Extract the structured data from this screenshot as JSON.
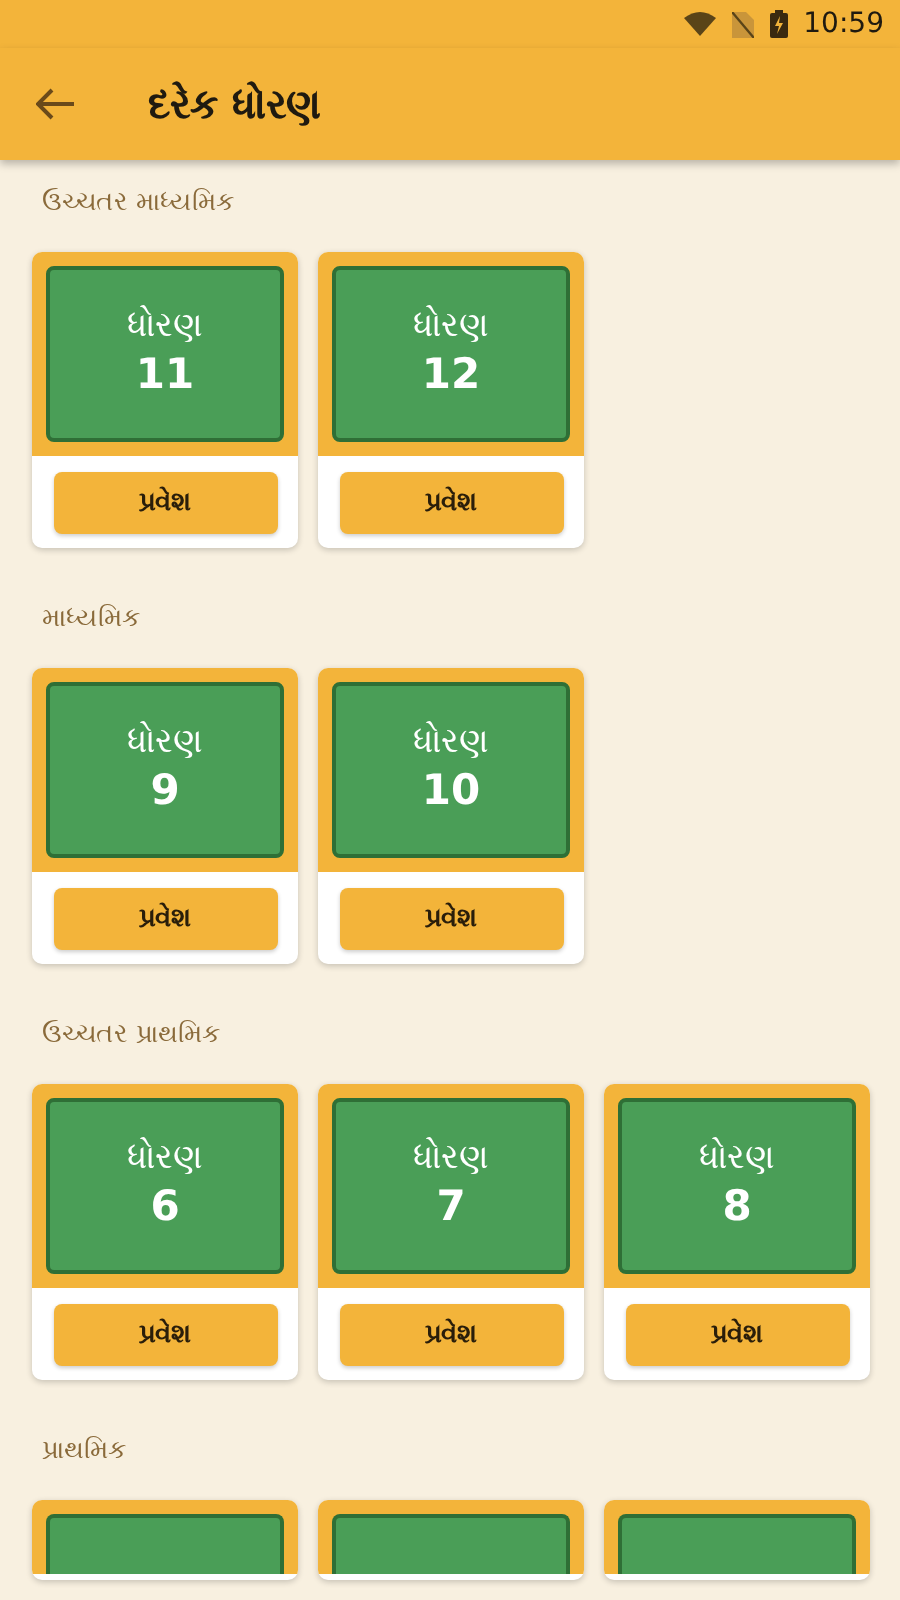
{
  "status_bar": {
    "time": "10:59"
  },
  "toolbar": {
    "title": "દરેક ધોરણ"
  },
  "sections": [
    {
      "title": "ઉચ્ચતર માધ્યમિક",
      "cards": [
        {
          "kind": "full",
          "label": "ધોરણ",
          "number": "11",
          "button": "પ્રવેશ"
        },
        {
          "kind": "full",
          "label": "ધોરણ",
          "number": "12",
          "button": "પ્રવેશ"
        }
      ]
    },
    {
      "title": "માધ્યમિક",
      "cards": [
        {
          "kind": "full",
          "label": "ધોરણ",
          "number": "9",
          "button": "પ્રવેશ"
        },
        {
          "kind": "full",
          "label": "ધોરણ",
          "number": "10",
          "button": "પ્રવેશ"
        }
      ]
    },
    {
      "title": "ઉચ્ચતર પ્રાથમિક",
      "cards": [
        {
          "kind": "full",
          "label": "ધોરણ",
          "number": "6",
          "button": "પ્રવેશ"
        },
        {
          "kind": "full",
          "label": "ધોરણ",
          "number": "7",
          "button": "પ્રવેશ"
        },
        {
          "kind": "full",
          "label": "ધોરણ",
          "number": "8",
          "button": "પ્રવેશ"
        }
      ]
    },
    {
      "title": "પ્રાથમિક",
      "cards": [
        {
          "kind": "cut"
        },
        {
          "kind": "cut"
        },
        {
          "kind": "cut"
        }
      ]
    }
  ]
}
